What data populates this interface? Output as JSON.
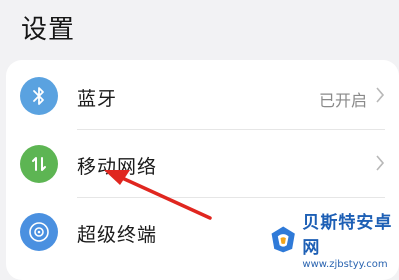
{
  "page": {
    "title": "设置"
  },
  "rows": [
    {
      "label": "蓝牙",
      "value": "已开启",
      "icon": "bluetooth-icon",
      "icon_color": "#5aa2e0"
    },
    {
      "label": "移动网络",
      "value": "",
      "icon": "mobile-data-icon",
      "icon_color": "#5db553"
    },
    {
      "label": "超级终端",
      "value": "",
      "icon": "super-device-icon",
      "icon_color": "#4a90e0"
    }
  ],
  "watermark": {
    "title": "贝斯特安卓网",
    "url": "www.zjbstyy.com"
  },
  "annotation": {
    "arrow_color": "#e0261f"
  }
}
